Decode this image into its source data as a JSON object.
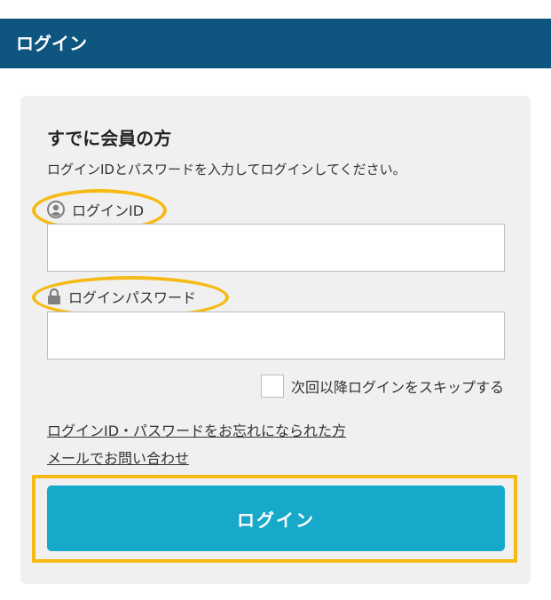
{
  "header": {
    "title": "ログイン"
  },
  "login_section": {
    "title": "すでに会員の方",
    "description": "ログインIDとパスワードを入力してログインしてください。",
    "login_id_label": "ログインID",
    "login_id_value": "",
    "password_label": "ログインパスワード",
    "password_value": "",
    "skip_login_label": "次回以降ログインをスキップする",
    "skip_login_checked": false,
    "forgot_link": "ログインID・パスワードをお忘れになられた方",
    "contact_link": "メールでお問い合わせ",
    "login_button": "ログイン"
  },
  "icons": {
    "login_id": "user-circle-icon",
    "password": "lock-icon"
  },
  "colors": {
    "header_bg": "#0e5680",
    "panel_bg": "#f0f0f0",
    "button_bg": "#16a9c9",
    "highlight": "#f6ba14"
  }
}
